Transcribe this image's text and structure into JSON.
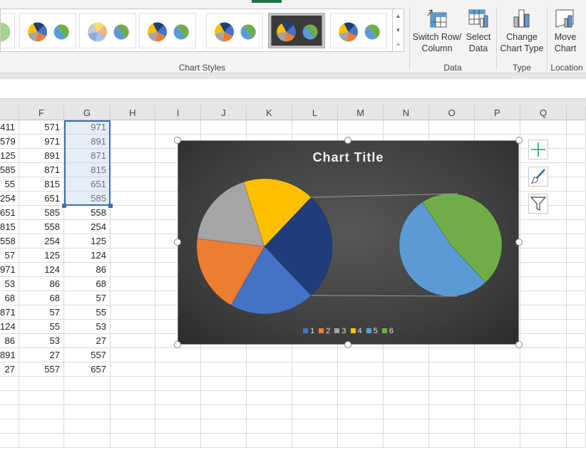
{
  "ribbon": {
    "gallery_label": "Chart Styles",
    "groups": {
      "data": {
        "label": "Data",
        "switch_row_column": "Switch Row/ Column",
        "switch_l1": "Switch Row/",
        "switch_l2": "Column",
        "select_l1": "Select",
        "select_l2": "Data"
      },
      "type": {
        "label": "Type",
        "change_l1": "Change",
        "change_l2": "Chart Type"
      },
      "location": {
        "label": "Location",
        "move_l1": "Move",
        "move_l2": "Chart"
      }
    },
    "selected_style_index": 5
  },
  "sheet": {
    "columns": [
      "F",
      "G",
      "H",
      "I",
      "J",
      "K",
      "L",
      "M",
      "N",
      "O",
      "P",
      "Q"
    ],
    "rows": [
      [
        "411",
        "571",
        "971"
      ],
      [
        "579",
        "971",
        "891"
      ],
      [
        "125",
        "891",
        "871"
      ],
      [
        "585",
        "871",
        "815"
      ],
      [
        "55",
        "815",
        "651"
      ],
      [
        "254",
        "651",
        "585"
      ],
      [
        "651",
        "585",
        "558"
      ],
      [
        "815",
        "558",
        "254"
      ],
      [
        "558",
        "254",
        "125"
      ],
      [
        "57",
        "125",
        "124"
      ],
      [
        "971",
        "124",
        "86"
      ],
      [
        "53",
        "86",
        "68"
      ],
      [
        "68",
        "68",
        "57"
      ],
      [
        "871",
        "57",
        "55"
      ],
      [
        "124",
        "55",
        "53"
      ],
      [
        "86",
        "53",
        "27"
      ],
      [
        "891",
        "27",
        "557"
      ],
      [
        "27",
        "557",
        "657"
      ]
    ],
    "selected_range": "G1:G6"
  },
  "chart_data": {
    "type": "pie-of-pie",
    "title": "Chart Title",
    "categories": [
      "1",
      "2",
      "3",
      "4",
      "5",
      "6"
    ],
    "values": [
      971,
      891,
      871,
      815,
      651,
      585
    ],
    "secondary_plot_categories": [
      "5",
      "6"
    ],
    "colors": [
      "#4472c4",
      "#ed7d31",
      "#a5a5a5",
      "#ffc000",
      "#5b9bd5",
      "#70ad47"
    ],
    "other_color": "#1f3d7a",
    "legend_position": "bottom",
    "style": "dark"
  },
  "chart_tools": {
    "add_element": "plus-icon",
    "styles": "brush-icon",
    "filters": "filter-icon"
  }
}
